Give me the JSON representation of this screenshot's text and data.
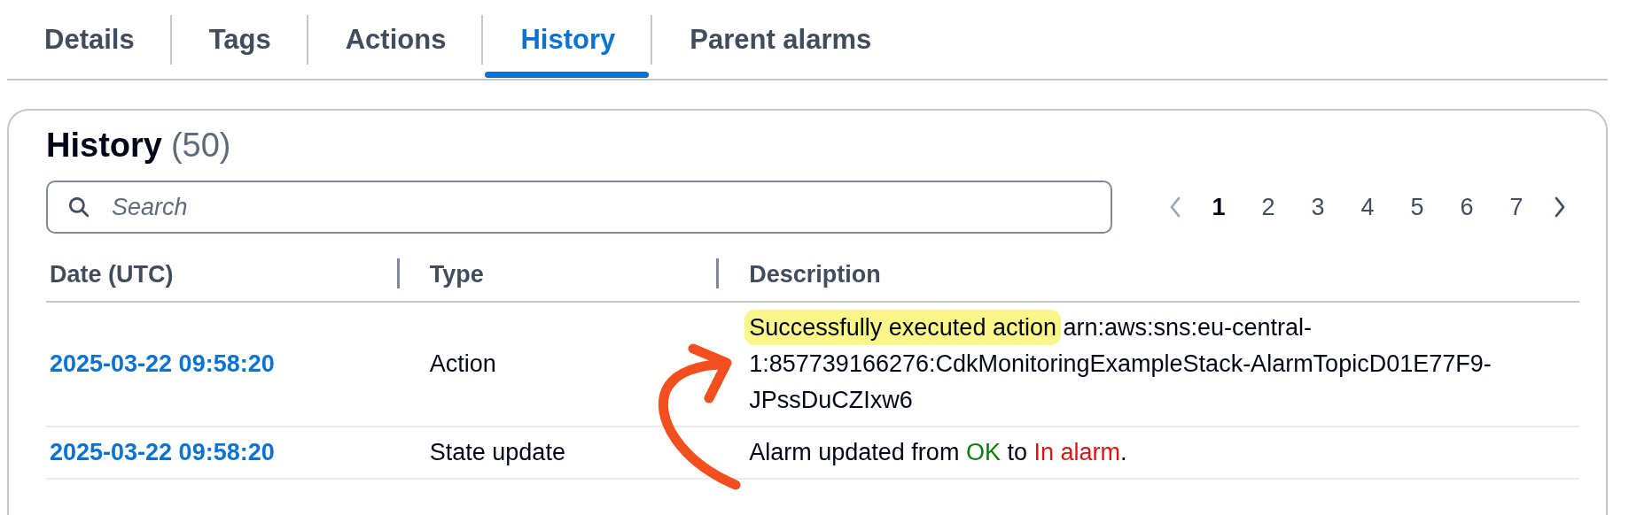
{
  "tabs": [
    {
      "label": "Details",
      "selected": false
    },
    {
      "label": "Tags",
      "selected": false
    },
    {
      "label": "Actions",
      "selected": false
    },
    {
      "label": "History",
      "selected": true
    },
    {
      "label": "Parent alarms",
      "selected": false
    }
  ],
  "panel": {
    "title": "History",
    "count": "(50)",
    "search": {
      "placeholder": "Search"
    },
    "pagination": {
      "prev_disabled": true,
      "next_disabled": false,
      "pages": [
        {
          "label": "1",
          "selected": true
        },
        {
          "label": "2",
          "selected": false
        },
        {
          "label": "3",
          "selected": false
        },
        {
          "label": "4",
          "selected": false
        },
        {
          "label": "5",
          "selected": false
        },
        {
          "label": "6",
          "selected": false
        },
        {
          "label": "7",
          "selected": false
        }
      ]
    },
    "table": {
      "columns": [
        "Date (UTC)",
        "Type",
        "Description"
      ],
      "rows": [
        {
          "date": "2025-03-22 09:58:20",
          "type": "Action",
          "description": [
            {
              "text": "Successfully executed action",
              "highlighted": true
            },
            {
              "text": " arn:aws:sns:eu-central-1:857739166276:CdkMonitoringExampleStack-AlarmTopicD01E77F9-JPssDuCZIxw6",
              "highlighted": false
            }
          ]
        },
        {
          "date": "2025-03-22 09:58:20",
          "type": "State update",
          "description": [
            {
              "text": "Alarm updated from ",
              "highlighted": false
            },
            {
              "text": "OK",
              "highlighted": false,
              "color": "#037f0c"
            },
            {
              "text": " to ",
              "highlighted": false
            },
            {
              "text": "In alarm",
              "highlighted": false,
              "color": "#d91515"
            },
            {
              "text": ".",
              "highlighted": false
            }
          ]
        }
      ]
    }
  }
}
